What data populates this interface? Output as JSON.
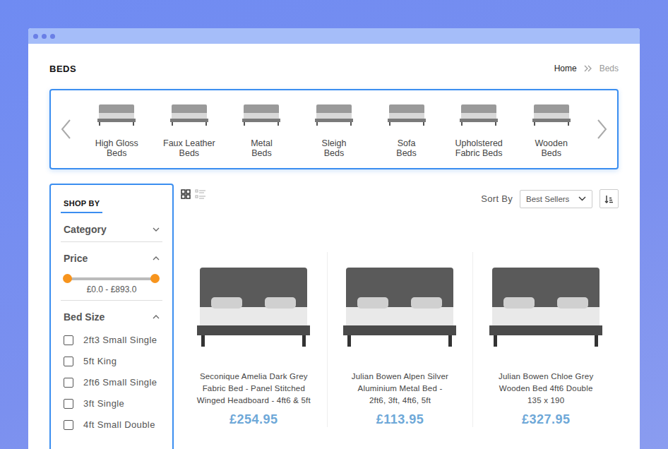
{
  "page": {
    "title": "BEDS"
  },
  "breadcrumb": [
    {
      "label": "Home",
      "current": false
    },
    {
      "label": "Beds",
      "current": true
    }
  ],
  "categories": [
    {
      "label_lines": [
        "High Gloss",
        "Beds"
      ]
    },
    {
      "label_lines": [
        "Faux Leather",
        "Beds"
      ]
    },
    {
      "label_lines": [
        "Metal",
        "Beds"
      ]
    },
    {
      "label_lines": [
        "Sleigh",
        "Beds"
      ]
    },
    {
      "label_lines": [
        "Sofa",
        "Beds"
      ]
    },
    {
      "label_lines": [
        "Upholstered",
        "Fabric Beds"
      ]
    },
    {
      "label_lines": [
        "Wooden",
        "Beds"
      ]
    }
  ],
  "sidebar": {
    "heading": "SHOP BY",
    "sections": [
      {
        "title": "Category",
        "expanded": false
      },
      {
        "title": "Price",
        "expanded": true
      },
      {
        "title": "Bed Size",
        "expanded": true
      }
    ],
    "price": {
      "low": 0,
      "high": 1,
      "reading": "£0.0 - £893.0"
    },
    "bed_sizes": [
      {
        "label": "2ft3 Small Single",
        "checked": false
      },
      {
        "label": "5ft King",
        "checked": false
      },
      {
        "label": "2ft6 Small Single",
        "checked": false
      },
      {
        "label": "3ft Single",
        "checked": false
      },
      {
        "label": "4ft Small Double",
        "checked": false
      }
    ]
  },
  "view_modes": [
    {
      "kind": "grid",
      "selected": true
    },
    {
      "kind": "list",
      "selected": false
    }
  ],
  "sort": {
    "label": "Sort By",
    "value": "Best Sellers"
  },
  "products": [
    {
      "title_lines": [
        "Seconique Amelia Dark Grey",
        "Fabric Bed - Panel Stitched",
        "Winged Headboard - 4ft6 & 5ft"
      ],
      "price": "£254.95"
    },
    {
      "title_lines": [
        "Julian Bowen Alpen Silver",
        "Aluminium Metal Bed -",
        "2ft6, 3ft, 4ft6, 5ft"
      ],
      "price": "£113.95"
    },
    {
      "title_lines": [
        "Julian Bowen Chloe Grey",
        "Wooden Bed 4ft6 Double",
        "135 x 190"
      ],
      "price": "£327.95"
    }
  ]
}
